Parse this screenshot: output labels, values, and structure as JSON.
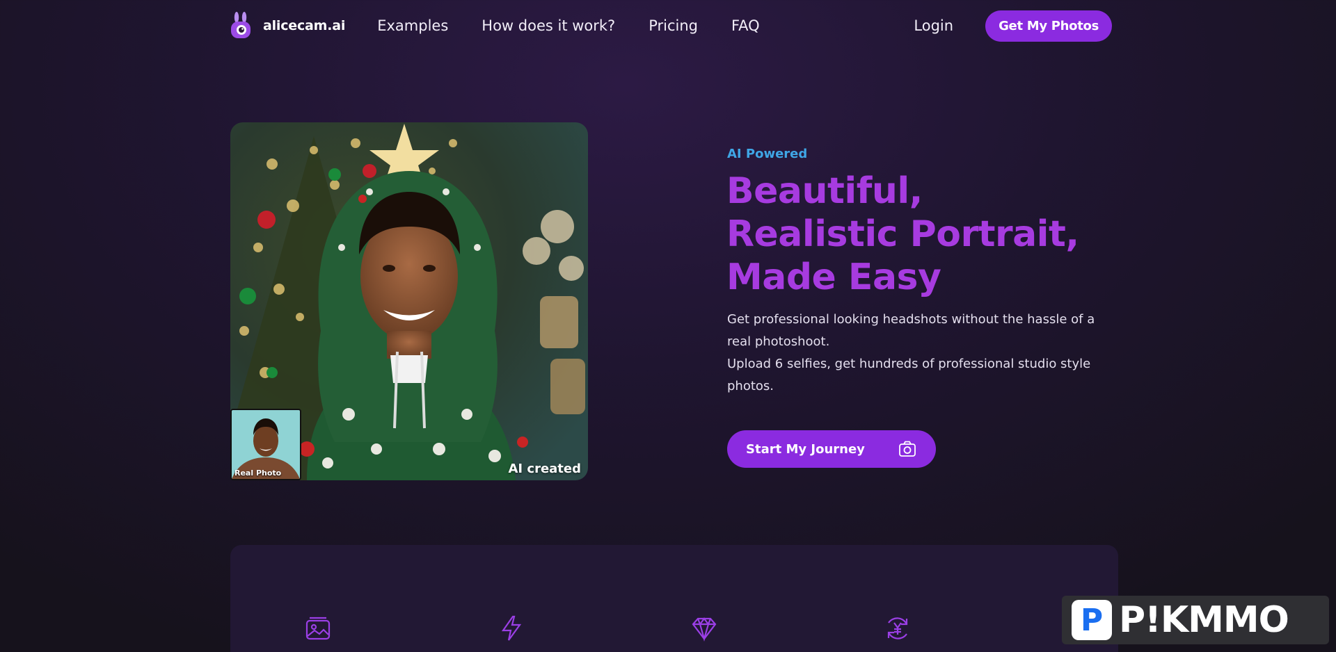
{
  "brand": {
    "name": "alicecam.ai",
    "logo_icon": "rabbit-camera-icon"
  },
  "nav": {
    "links": [
      "Examples",
      "How does it work?",
      "Pricing",
      "FAQ"
    ],
    "login": "Login",
    "cta": "Get My Photos"
  },
  "hero": {
    "eyebrow": "AI Powered",
    "headline": [
      "Beautiful,",
      "Realistic Portrait,",
      "Made Easy"
    ],
    "sub_1": "Get professional looking headshots without the hassle of a real photoshoot.",
    "sub_2": "Upload 6 selfies, get hundreds of professional studio style photos.",
    "cta": "Start My Journey",
    "cta_icon": "camera-icon",
    "image_label": "AI created",
    "thumb_label": "Real Photo"
  },
  "features": {
    "icons": [
      "image-icon",
      "lightning-icon",
      "diamond-icon",
      "currency-refresh-icon"
    ]
  },
  "watermark": {
    "badge": "P",
    "text": "P!KMMO"
  },
  "colors": {
    "accent": "#8b2be0",
    "headline": "#a73be0",
    "eyebrow": "#3fa6e6",
    "background": "#1b1426"
  }
}
